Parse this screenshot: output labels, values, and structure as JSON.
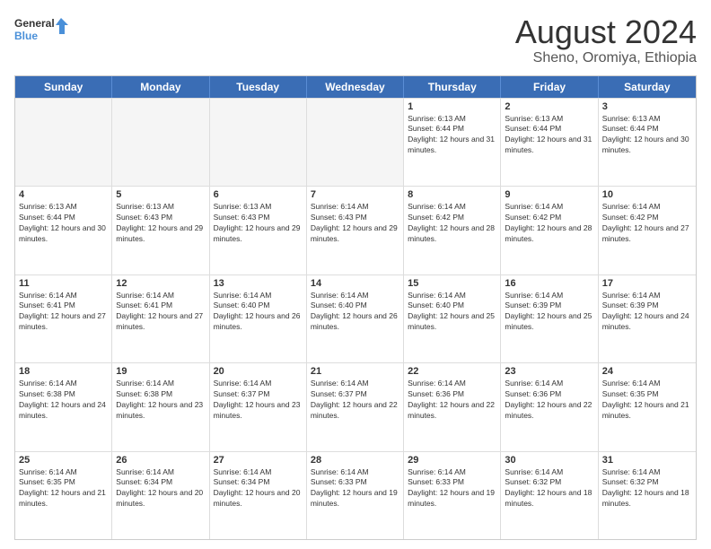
{
  "logo": {
    "line1": "General",
    "line2": "Blue"
  },
  "title": "August 2024",
  "subtitle": "Sheno, Oromiya, Ethiopia",
  "days": [
    "Sunday",
    "Monday",
    "Tuesday",
    "Wednesday",
    "Thursday",
    "Friday",
    "Saturday"
  ],
  "weeks": [
    [
      {
        "day": "",
        "empty": true
      },
      {
        "day": "",
        "empty": true
      },
      {
        "day": "",
        "empty": true
      },
      {
        "day": "",
        "empty": true
      },
      {
        "day": "1",
        "rise": "6:13 AM",
        "set": "6:44 PM",
        "daylight": "12 hours and 31 minutes."
      },
      {
        "day": "2",
        "rise": "6:13 AM",
        "set": "6:44 PM",
        "daylight": "12 hours and 31 minutes."
      },
      {
        "day": "3",
        "rise": "6:13 AM",
        "set": "6:44 PM",
        "daylight": "12 hours and 30 minutes."
      }
    ],
    [
      {
        "day": "4",
        "rise": "6:13 AM",
        "set": "6:44 PM",
        "daylight": "12 hours and 30 minutes."
      },
      {
        "day": "5",
        "rise": "6:13 AM",
        "set": "6:43 PM",
        "daylight": "12 hours and 29 minutes."
      },
      {
        "day": "6",
        "rise": "6:13 AM",
        "set": "6:43 PM",
        "daylight": "12 hours and 29 minutes."
      },
      {
        "day": "7",
        "rise": "6:14 AM",
        "set": "6:43 PM",
        "daylight": "12 hours and 29 minutes."
      },
      {
        "day": "8",
        "rise": "6:14 AM",
        "set": "6:42 PM",
        "daylight": "12 hours and 28 minutes."
      },
      {
        "day": "9",
        "rise": "6:14 AM",
        "set": "6:42 PM",
        "daylight": "12 hours and 28 minutes."
      },
      {
        "day": "10",
        "rise": "6:14 AM",
        "set": "6:42 PM",
        "daylight": "12 hours and 27 minutes."
      }
    ],
    [
      {
        "day": "11",
        "rise": "6:14 AM",
        "set": "6:41 PM",
        "daylight": "12 hours and 27 minutes."
      },
      {
        "day": "12",
        "rise": "6:14 AM",
        "set": "6:41 PM",
        "daylight": "12 hours and 27 minutes."
      },
      {
        "day": "13",
        "rise": "6:14 AM",
        "set": "6:40 PM",
        "daylight": "12 hours and 26 minutes."
      },
      {
        "day": "14",
        "rise": "6:14 AM",
        "set": "6:40 PM",
        "daylight": "12 hours and 26 minutes."
      },
      {
        "day": "15",
        "rise": "6:14 AM",
        "set": "6:40 PM",
        "daylight": "12 hours and 25 minutes."
      },
      {
        "day": "16",
        "rise": "6:14 AM",
        "set": "6:39 PM",
        "daylight": "12 hours and 25 minutes."
      },
      {
        "day": "17",
        "rise": "6:14 AM",
        "set": "6:39 PM",
        "daylight": "12 hours and 24 minutes."
      }
    ],
    [
      {
        "day": "18",
        "rise": "6:14 AM",
        "set": "6:38 PM",
        "daylight": "12 hours and 24 minutes."
      },
      {
        "day": "19",
        "rise": "6:14 AM",
        "set": "6:38 PM",
        "daylight": "12 hours and 23 minutes."
      },
      {
        "day": "20",
        "rise": "6:14 AM",
        "set": "6:37 PM",
        "daylight": "12 hours and 23 minutes."
      },
      {
        "day": "21",
        "rise": "6:14 AM",
        "set": "6:37 PM",
        "daylight": "12 hours and 22 minutes."
      },
      {
        "day": "22",
        "rise": "6:14 AM",
        "set": "6:36 PM",
        "daylight": "12 hours and 22 minutes."
      },
      {
        "day": "23",
        "rise": "6:14 AM",
        "set": "6:36 PM",
        "daylight": "12 hours and 22 minutes."
      },
      {
        "day": "24",
        "rise": "6:14 AM",
        "set": "6:35 PM",
        "daylight": "12 hours and 21 minutes."
      }
    ],
    [
      {
        "day": "25",
        "rise": "6:14 AM",
        "set": "6:35 PM",
        "daylight": "12 hours and 21 minutes."
      },
      {
        "day": "26",
        "rise": "6:14 AM",
        "set": "6:34 PM",
        "daylight": "12 hours and 20 minutes."
      },
      {
        "day": "27",
        "rise": "6:14 AM",
        "set": "6:34 PM",
        "daylight": "12 hours and 20 minutes."
      },
      {
        "day": "28",
        "rise": "6:14 AM",
        "set": "6:33 PM",
        "daylight": "12 hours and 19 minutes."
      },
      {
        "day": "29",
        "rise": "6:14 AM",
        "set": "6:33 PM",
        "daylight": "12 hours and 19 minutes."
      },
      {
        "day": "30",
        "rise": "6:14 AM",
        "set": "6:32 PM",
        "daylight": "12 hours and 18 minutes."
      },
      {
        "day": "31",
        "rise": "6:14 AM",
        "set": "6:32 PM",
        "daylight": "12 hours and 18 minutes."
      }
    ]
  ],
  "labels": {
    "sunrise": "Sunrise:",
    "sunset": "Sunset:",
    "daylight": "Daylight:"
  }
}
